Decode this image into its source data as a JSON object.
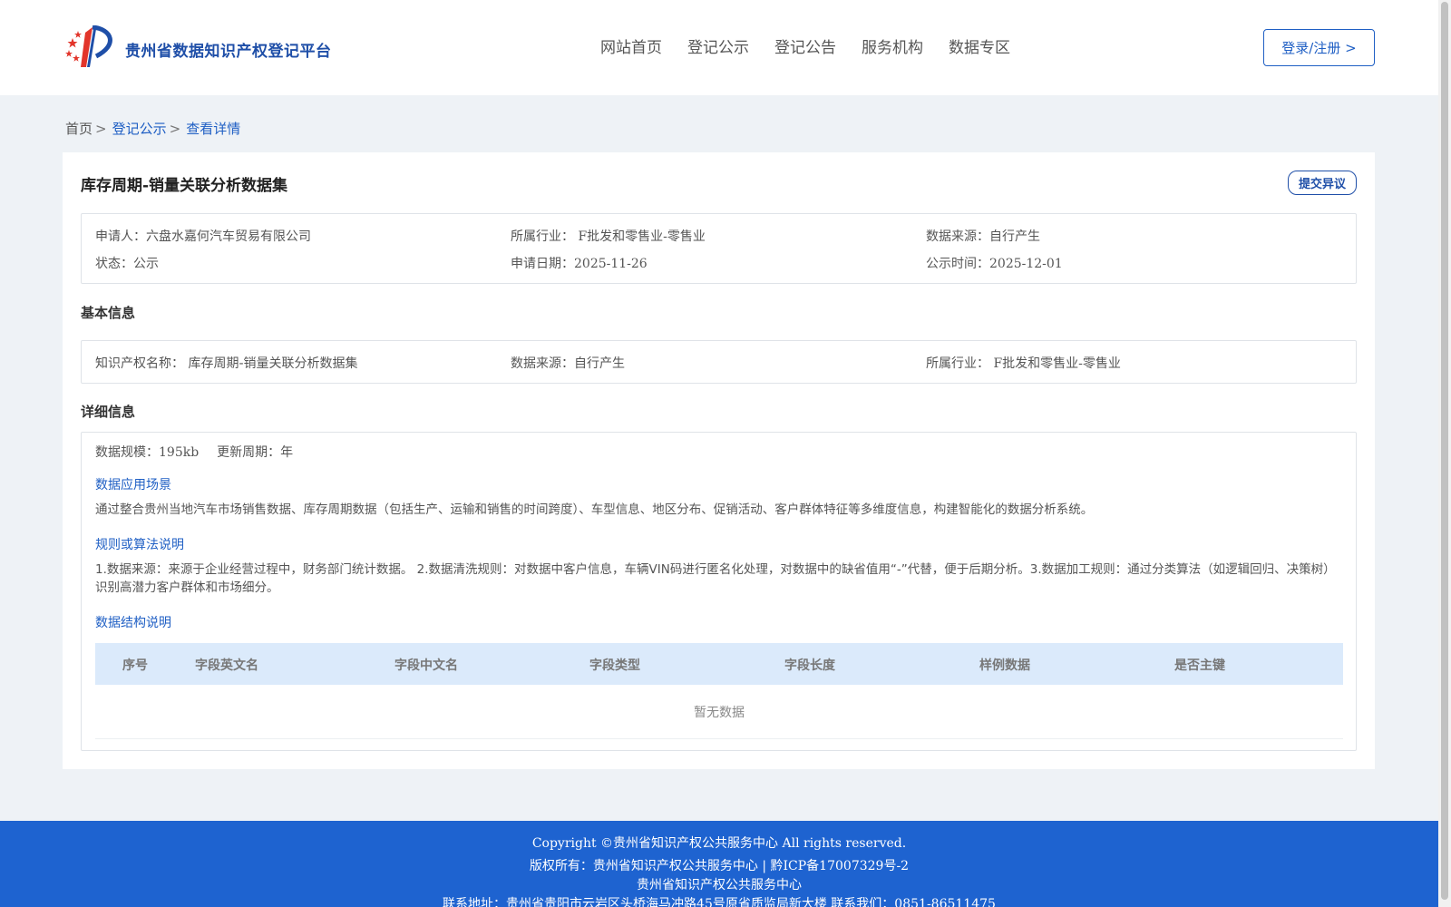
{
  "header": {
    "site_title": "贵州省数据知识产权登记平台",
    "nav": [
      "网站首页",
      "登记公示",
      "登记公告",
      "服务机构",
      "数据专区"
    ],
    "login_label": "登录/注册 >"
  },
  "breadcrumb": {
    "home": "首页",
    "sep": ">",
    "level1": "登记公示",
    "current": "查看详情"
  },
  "record": {
    "title": "库存周期-销量关联分析数据集",
    "objection_label": "提交异议",
    "summary": {
      "applicant_label": "申请人：",
      "applicant": "六盘水嘉何汽车贸易有限公司",
      "industry_label": "所属行业：",
      "industry": "F批发和零售业-零售业",
      "source_label": "数据来源：",
      "source": "自行产生",
      "status_label": "状态：",
      "status": "公示",
      "apply_date_label": "申请日期：",
      "apply_date": "2025-11-26",
      "publish_time_label": "公示时间：",
      "publish_time": "2025-12-01"
    },
    "basic": {
      "section_title": "基本信息",
      "ip_name_label": "知识产权名称：",
      "ip_name": "库存周期-销量关联分析数据集",
      "source_label": "数据来源：",
      "source": "自行产生",
      "industry_label": "所属行业：",
      "industry": "F批发和零售业-零售业"
    },
    "detail": {
      "section_title": "详细信息",
      "scale_label": "数据规模：",
      "scale": "195kb",
      "cycle_label": "更新周期：",
      "cycle": "年",
      "scenario_title": "数据应用场景",
      "scenario_text": "通过整合贵州当地汽车市场销售数据、库存周期数据（包括生产、运输和销售的时间跨度）、车型信息、地区分布、促销活动、客户群体特征等多维度信息，构建智能化的数据分析系统。",
      "rules_title": "规则或算法说明",
      "rules_text": "1.数据来源：来源于企业经营过程中，财务部门统计数据。 2.数据清洗规则：对数据中客户信息，车辆VIN码进行匿名化处理，对数据中的缺省值用“-”代替，便于后期分析。3.数据加工规则：通过分类算法（如逻辑回归、决策树）识别高潜力客户群体和市场细分。",
      "structure_title": "数据结构说明",
      "table_headers": [
        "序号",
        "字段英文名",
        "字段中文名",
        "字段类型",
        "字段长度",
        "样例数据",
        "是否主键"
      ],
      "empty_text": "暂无数据"
    }
  },
  "footer": {
    "copyright": "Copyright ©贵州省知识产权公共服务中心 All rights reserved.",
    "owner": "版权所有：贵州省知识产权公共服务中心 | 黔ICP备17007329号-2",
    "org": "贵州省知识产权公共服务中心",
    "contact": "联系地址：贵州省贵阳市云岩区头桥海马冲路45号原省质监局新大楼 联系我们：0851-86511475"
  },
  "colors": {
    "brand_blue": "#1f5fc4",
    "footer_blue": "#1e63d0",
    "table_head_bg": "#dbeafb",
    "logo_red": "#e2352b"
  }
}
